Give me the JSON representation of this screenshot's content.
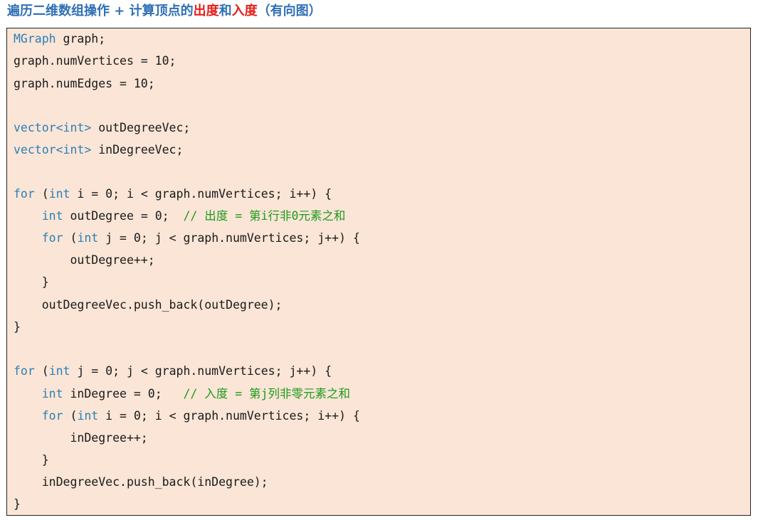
{
  "heading": {
    "part1": "遍历二维数组操作 + 计算顶点的",
    "out_degree": "出度",
    "and": "和",
    "in_degree": "入度",
    "part2": "（有向图）"
  },
  "colors": {
    "heading": "#2f6fb5",
    "highlight": "#e3201b",
    "code_bg": "#fae5d6",
    "keyword": "#2b7fb6",
    "comment": "#1e9a1e"
  },
  "code": {
    "l1": {
      "t1": "MGraph",
      "t2": " graph;"
    },
    "l2": {
      "t1": "graph.numVertices = 10;"
    },
    "l3": {
      "t1": "graph.numEdges = 10;"
    },
    "l4": {
      "t1": "vector<int>",
      "t2": " outDegreeVec;"
    },
    "l5": {
      "t1": "vector<int>",
      "t2": " inDegreeVec;"
    },
    "l6": {
      "t1": "for",
      "t2": " (",
      "t3": "int",
      "t4": " i = 0; i < graph.numVertices; i++) {"
    },
    "l7": {
      "t1": "    ",
      "t2": "int",
      "t3": " outDegree = 0;  ",
      "t4": "// 出度 = 第i行非0元素之和"
    },
    "l8": {
      "t1": "    ",
      "t2": "for",
      "t3": " (",
      "t4": "int",
      "t5": " j = 0; j < graph.numVertices; j++) {"
    },
    "l9": {
      "t1": "        outDegree++;"
    },
    "l10": {
      "t1": "    }"
    },
    "l11": {
      "t1": "    outDegreeVec.push_back(outDegree);"
    },
    "l12": {
      "t1": "}"
    },
    "l13": {
      "t1": "for",
      "t2": " (",
      "t3": "int",
      "t4": " j = 0; j < graph.numVertices; j++) {"
    },
    "l14": {
      "t1": "    ",
      "t2": "int",
      "t3": " inDegree = 0;   ",
      "t4": "// 入度 = 第j列非零元素之和"
    },
    "l15": {
      "t1": "    ",
      "t2": "for",
      "t3": " (",
      "t4": "int",
      "t5": " i = 0; i < graph.numVertices; i++) {"
    },
    "l16": {
      "t1": "        inDegree++;"
    },
    "l17": {
      "t1": "    }"
    },
    "l18": {
      "t1": "    inDegreeVec.push_back(inDegree);"
    },
    "l19": {
      "t1": "}"
    }
  }
}
